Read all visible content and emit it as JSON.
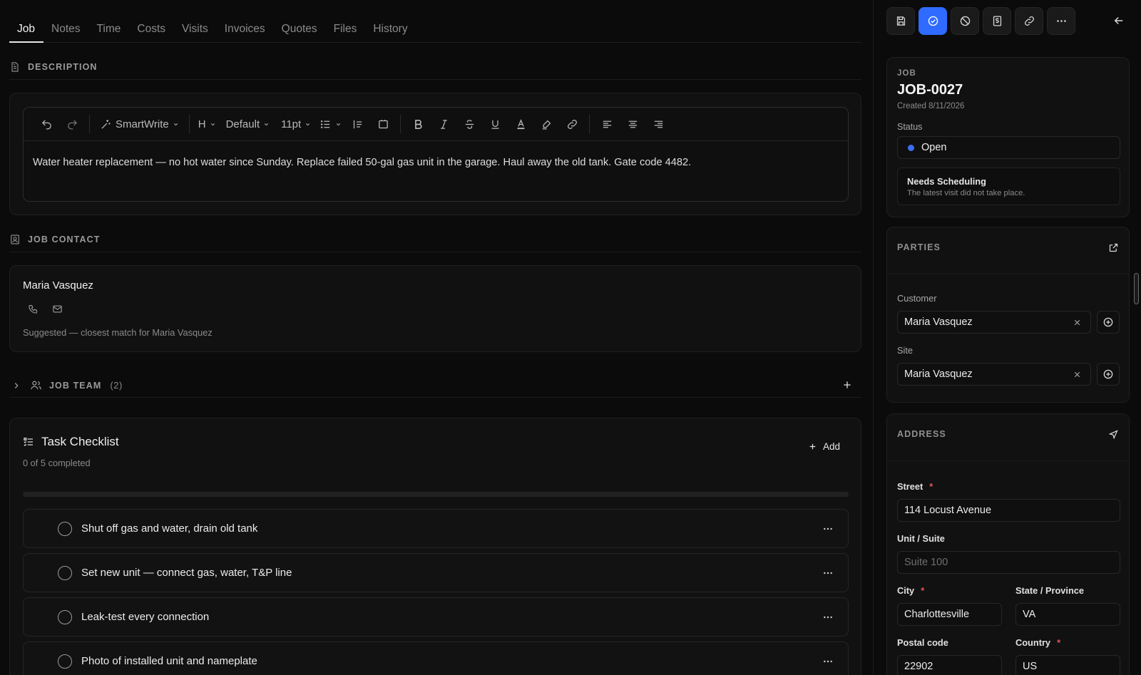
{
  "tabs": [
    "Job",
    "Notes",
    "Time",
    "Costs",
    "Visits",
    "Invoices",
    "Quotes",
    "Files",
    "History"
  ],
  "description": {
    "heading": "DESCRIPTION",
    "toolbar": {
      "smartwrite": "SmartWrite",
      "heading": "H",
      "font": "Default",
      "size": "11pt"
    },
    "text": "Water heater replacement — no hot water since Sunday. Replace failed 50-gal gas unit in the garage. Haul away the old tank. Gate code 4482."
  },
  "contact": {
    "heading": "JOB CONTACT",
    "name": "Maria Vasquez",
    "suggestion": "Suggested — closest match for Maria Vasquez"
  },
  "team": {
    "label": "JOB TEAM",
    "count": "(2)"
  },
  "checklist": {
    "title": "Task Checklist",
    "summary": "0 of 5 completed",
    "add_label": "Add",
    "progress": 0,
    "accent": "#3a7bff",
    "items": [
      "Shut off gas and water, drain old tank",
      "Set new unit — connect gas, water, T&P line",
      "Leak-test every connection",
      "Photo of installed unit and nameplate"
    ]
  },
  "panel": {
    "job_label": "JOB",
    "job_id": "JOB-0027",
    "created": "Created 8/11/2026",
    "status_label": "Status",
    "status": "Open",
    "status_color": "#3b6df0",
    "notice_title": "Needs Scheduling",
    "notice_text": "The latest visit did not take place.",
    "parties": {
      "heading": "PARTIES",
      "customer_label": "Customer",
      "customer": "Maria Vasquez",
      "site_label": "Site",
      "site": "Maria Vasquez"
    },
    "address": {
      "heading": "ADDRESS",
      "street_label": "Street",
      "street": "114 Locust Avenue",
      "unit_label": "Unit / Suite",
      "unit_placeholder": "Suite 100",
      "city_label": "City",
      "city": "Charlottesville",
      "state_label": "State / Province",
      "state": "VA",
      "postal_label": "Postal code",
      "postal": "22902",
      "country_label": "Country",
      "country": "US",
      "required_mark": "*"
    }
  }
}
